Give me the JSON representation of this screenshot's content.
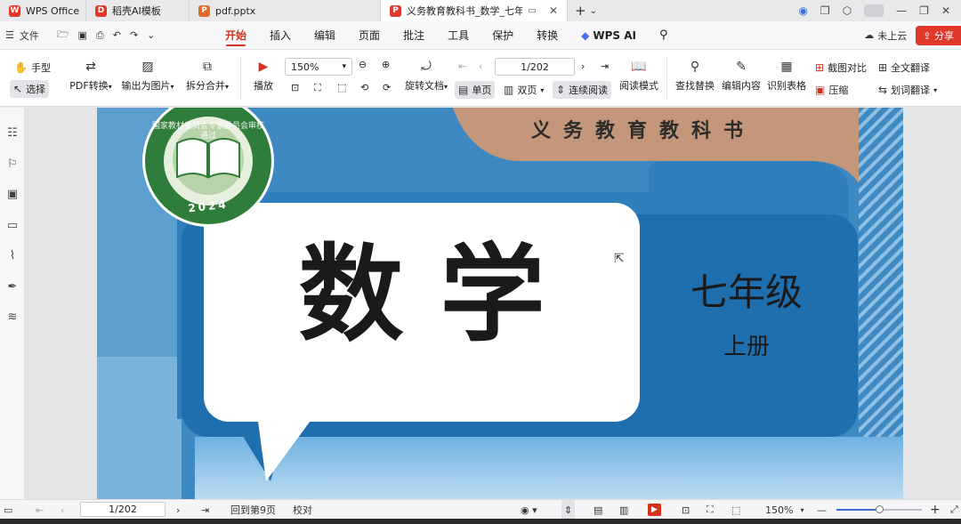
{
  "tabs": [
    {
      "label": "WPS Office",
      "color": "#e0382a",
      "glyph": "W"
    },
    {
      "label": "稻壳AI模板",
      "color": "#e0382a",
      "glyph": "D"
    },
    {
      "label": "pdf.pptx",
      "color": "#e06a2a",
      "glyph": "P"
    },
    {
      "label": "义务教育教科书_数学_七年级",
      "color": "#e0382a",
      "glyph": "P"
    }
  ],
  "menubar": {
    "file_label": "文件",
    "menus": [
      "开始",
      "插入",
      "编辑",
      "页面",
      "批注",
      "工具",
      "保护",
      "转换"
    ],
    "wps_ai": "WPS AI",
    "cloud_label": "未上云",
    "share_label": "分享"
  },
  "toolbar": {
    "hand": "手型",
    "select": "选择",
    "pdf_convert": "PDF转换",
    "export_image": "输出为图片",
    "split_merge": "拆分合并",
    "play": "播放",
    "zoom": "150%",
    "rotate": "旋转文档",
    "page_indicator": "1/202",
    "single": "单页",
    "double": "双页",
    "continuous": "连续阅读",
    "read_mode": "阅读模式",
    "find_replace": "查找替换",
    "edit_content": "编辑内容",
    "recognize_table": "识别表格",
    "screenshot_compare": "截图对比",
    "compress": "压缩",
    "full_translate": "全文翻译",
    "word_translate": "划词翻译"
  },
  "document": {
    "series_title": "义务教育教科书",
    "subject": "数 学",
    "grade": "七年级",
    "volume": "上册",
    "seal_text": "国家教材委员会专家委员会审核通过",
    "seal_year": "2024"
  },
  "statusbar": {
    "page_indicator": "1/202",
    "back_to_page": "回到第9页",
    "proofread": "校对",
    "zoom": "150%"
  },
  "colors": {
    "accent": "#d4311e",
    "cover_blue": "#3f89c3",
    "cover_dark_blue": "#1f6fae",
    "cover_tan": "#c4977a",
    "seal_green": "#2f7d3a"
  }
}
